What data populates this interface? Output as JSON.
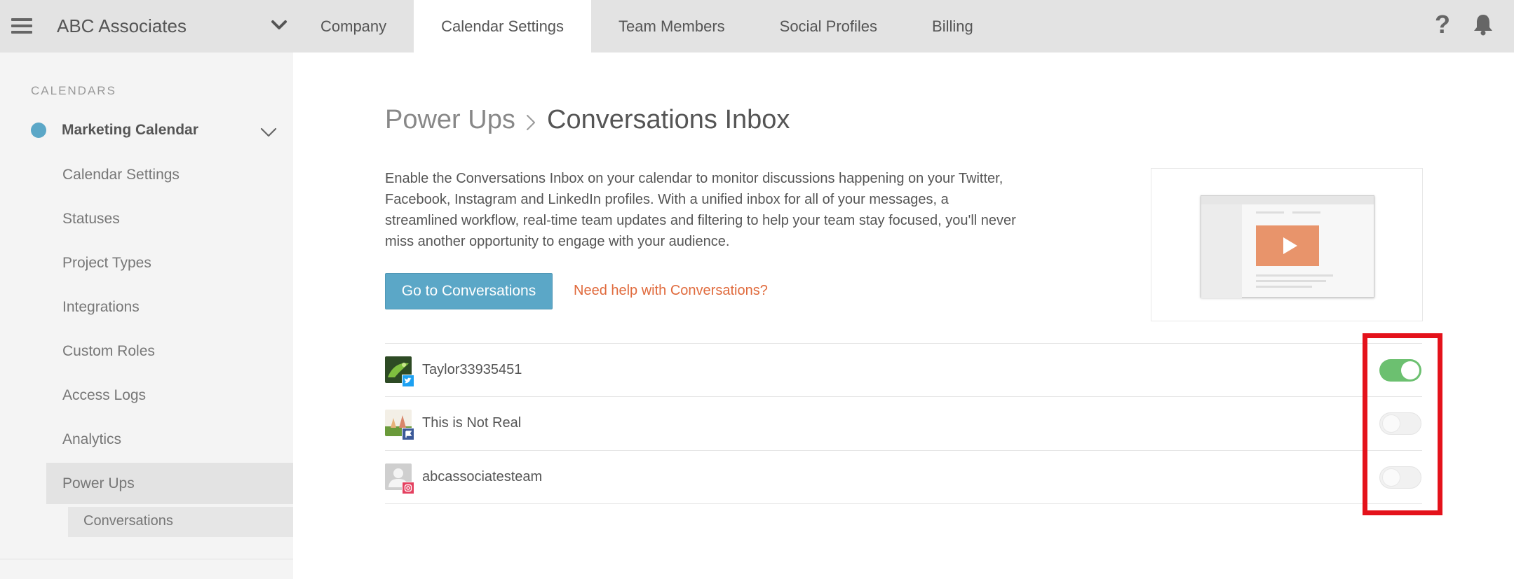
{
  "header": {
    "brand": "ABC Associates",
    "tabs": [
      {
        "label": "Company",
        "active": false
      },
      {
        "label": "Calendar Settings",
        "active": true
      },
      {
        "label": "Team Members",
        "active": false
      },
      {
        "label": "Social Profiles",
        "active": false
      },
      {
        "label": "Billing",
        "active": false
      }
    ],
    "help_glyph": "?"
  },
  "sidebar": {
    "heading": "CALENDARS",
    "calendar": {
      "name": "Marketing Calendar",
      "dot_color": "#5ba7c7"
    },
    "items": [
      {
        "label": "Calendar Settings"
      },
      {
        "label": "Statuses"
      },
      {
        "label": "Project Types"
      },
      {
        "label": "Integrations"
      },
      {
        "label": "Custom Roles"
      },
      {
        "label": "Access Logs"
      },
      {
        "label": "Analytics"
      },
      {
        "label": "Power Ups",
        "active": true
      }
    ],
    "subitem": "Conversations"
  },
  "main": {
    "breadcrumb": {
      "parent": "Power Ups",
      "current": "Conversations Inbox"
    },
    "description": "Enable the Conversations Inbox on your calendar to monitor discussions happening on your Twitter, Facebook, Instagram and LinkedIn profiles. With a unified inbox for all of your messages, a streamlined workflow, real-time team updates and filtering to help your team stay focused, you'll never miss another opportunity to engage with your audience.",
    "go_button": "Go to Conversations",
    "help_link": "Need help with Conversations?",
    "accounts": [
      {
        "name": "Taylor33935451",
        "network": "twitter",
        "enabled": true
      },
      {
        "name": "This is Not Real",
        "network": "facebook",
        "enabled": false
      },
      {
        "name": "abcassociatesteam",
        "network": "instagram",
        "enabled": false
      }
    ]
  },
  "colors": {
    "accent": "#5ba7c7",
    "link": "#e06a3c",
    "toggle_on": "#6cc070",
    "highlight": "#e4121b"
  }
}
